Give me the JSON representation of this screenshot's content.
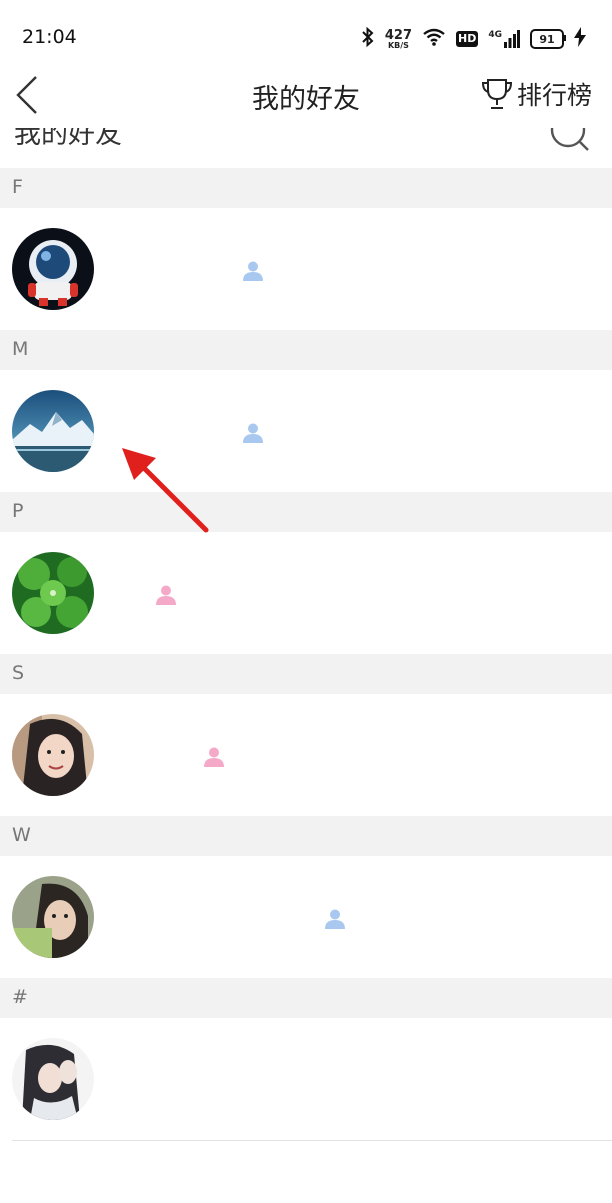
{
  "status_bar": {
    "time": "21:04",
    "net_speed_value": "427",
    "net_speed_unit": "KB/S",
    "hd_label": "HD",
    "network_label": "4G",
    "battery": "91"
  },
  "nav": {
    "title": "我的好友",
    "rank_label": "排行榜"
  },
  "search": {
    "remnant_text": "我的好友"
  },
  "sections": [
    {
      "letter": "F",
      "gender": "male"
    },
    {
      "letter": "M",
      "gender": "male"
    },
    {
      "letter": "P",
      "gender": "female"
    },
    {
      "letter": "S",
      "gender": "female"
    },
    {
      "letter": "W",
      "gender": "male"
    },
    {
      "letter": "#",
      "gender": "none"
    }
  ],
  "colors": {
    "male_icon": "#a9c8f0",
    "female_icon": "#f4a9c8",
    "annotation_arrow": "#e0201c",
    "section_bg": "#f2f2f2"
  },
  "icons": {
    "back": "chevron-left-icon",
    "rank": "trophy-icon",
    "search": "search-icon",
    "male": "user-male-icon",
    "female": "user-female-icon"
  }
}
